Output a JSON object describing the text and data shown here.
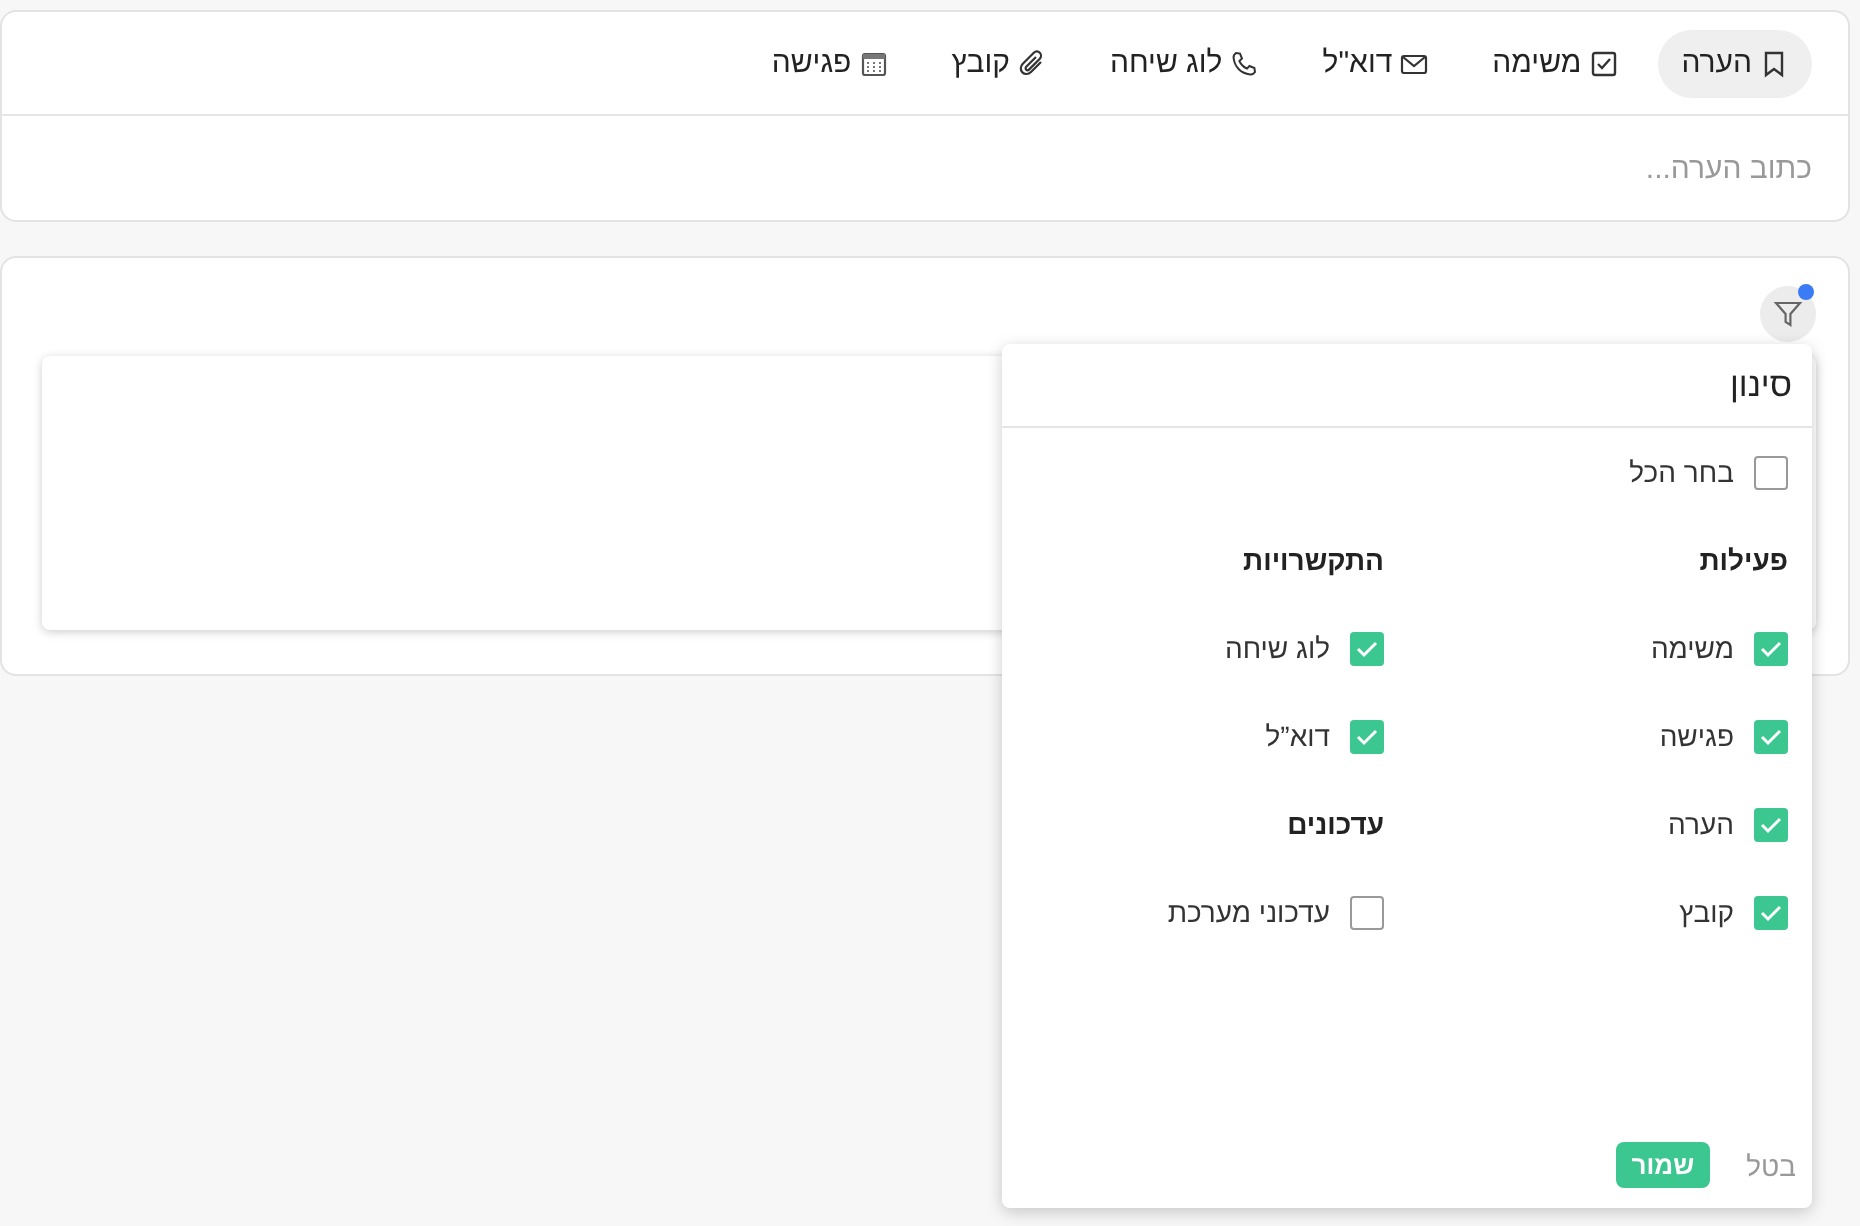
{
  "composer": {
    "tabs": [
      {
        "label": "הערה",
        "selected": true
      },
      {
        "label": "משימה",
        "selected": false
      },
      {
        "label": "דוא\"ל",
        "selected": false
      },
      {
        "label": "לוג שיחה",
        "selected": false
      },
      {
        "label": "קובץ",
        "selected": false
      },
      {
        "label": "פגישה",
        "selected": false
      }
    ],
    "note_field": {
      "placeholder": "כתוב הערה..."
    }
  },
  "feed": {
    "filter_button": {
      "active": true
    }
  },
  "filter_panel": {
    "title": "סינון",
    "select_all": {
      "label": "בחר הכל",
      "checked": false
    },
    "columns": [
      {
        "groups": [
          {
            "title": "פעילות",
            "items": [
              {
                "label": "משימה",
                "checked": true
              },
              {
                "label": "פגישה",
                "checked": true
              },
              {
                "label": "הערה",
                "checked": true
              },
              {
                "label": "קובץ",
                "checked": true
              }
            ]
          }
        ]
      },
      {
        "groups": [
          {
            "title": "התקשרויות",
            "items": [
              {
                "label": "לוג שיחה",
                "checked": true
              },
              {
                "label": "דוא”ל",
                "checked": true
              }
            ]
          },
          {
            "title": "עדכונים",
            "items": [
              {
                "label": "עדכוני מערכת",
                "checked": false
              }
            ]
          }
        ]
      }
    ],
    "buttons": {
      "save": "שמור",
      "cancel": "בטל"
    }
  }
}
